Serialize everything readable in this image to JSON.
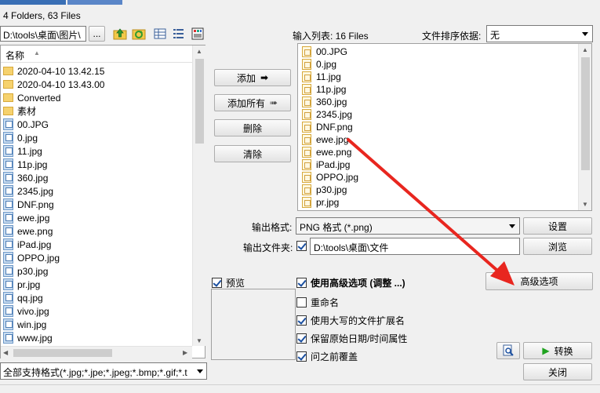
{
  "summary": "4 Folders, 63 Files",
  "path": "D:\\tools\\桌面\\图片\\",
  "browse_small": "...",
  "left_list": {
    "header": "名称",
    "items": [
      {
        "name": "2020-04-10 13.42.15",
        "type": "folder"
      },
      {
        "name": "2020-04-10 13.43.00",
        "type": "folder"
      },
      {
        "name": "Converted",
        "type": "folder"
      },
      {
        "name": "素材",
        "type": "folder"
      },
      {
        "name": "00.JPG",
        "type": "file"
      },
      {
        "name": "0.jpg",
        "type": "file"
      },
      {
        "name": "11.jpg",
        "type": "file"
      },
      {
        "name": "11p.jpg",
        "type": "file"
      },
      {
        "name": "360.jpg",
        "type": "file"
      },
      {
        "name": "2345.jpg",
        "type": "file"
      },
      {
        "name": "DNF.png",
        "type": "file"
      },
      {
        "name": "ewe.jpg",
        "type": "file"
      },
      {
        "name": "ewe.png",
        "type": "file"
      },
      {
        "name": "iPad.jpg",
        "type": "file"
      },
      {
        "name": "OPPO.jpg",
        "type": "file"
      },
      {
        "name": "p30.jpg",
        "type": "file"
      },
      {
        "name": "pr.jpg",
        "type": "file"
      },
      {
        "name": "qq.jpg",
        "type": "file"
      },
      {
        "name": "vivo.jpg",
        "type": "file"
      },
      {
        "name": "win.jpg",
        "type": "file"
      },
      {
        "name": "www.jpg",
        "type": "file"
      }
    ]
  },
  "format_filter": "全部支持格式(*.jpg;*.jpe;*.jpeg;*.bmp;*.gif;*.t",
  "buttons": {
    "add": "添加",
    "add_all": "添加所有",
    "remove": "删除",
    "clear": "清除",
    "settings": "设置",
    "browse": "浏览",
    "advanced": "高级选项",
    "convert": "转换",
    "close": "关闭"
  },
  "input_list_label": "输入列表:  16 Files",
  "sort_label": "文件排序依据:",
  "sort_value": "无",
  "right_list": [
    "00.JPG",
    "0.jpg",
    "11.jpg",
    "11p.jpg",
    "360.jpg",
    "2345.jpg",
    "DNF.png",
    "ewe.jpg",
    "ewe.png",
    "iPad.jpg",
    "OPPO.jpg",
    "p30.jpg",
    "pr.jpg"
  ],
  "output_format_label": "输出格式:",
  "output_format_value": "PNG 格式 (*.png)",
  "output_folder_label": "输出文件夹:",
  "output_folder_value": "D:\\tools\\桌面\\文件",
  "preview_label": "预览",
  "options": {
    "use_advanced": "使用高级选项 (调整 ...)",
    "rename": "重命名",
    "uppercase_ext": "使用大写的文件扩展名",
    "keep_date": "保留原始日期/时间属性",
    "overwrite": "问之前覆盖"
  },
  "colors": {
    "accent": "#1a4fa0",
    "green_arrow": "#1fa31f",
    "red_annotation": "#e8261f"
  }
}
